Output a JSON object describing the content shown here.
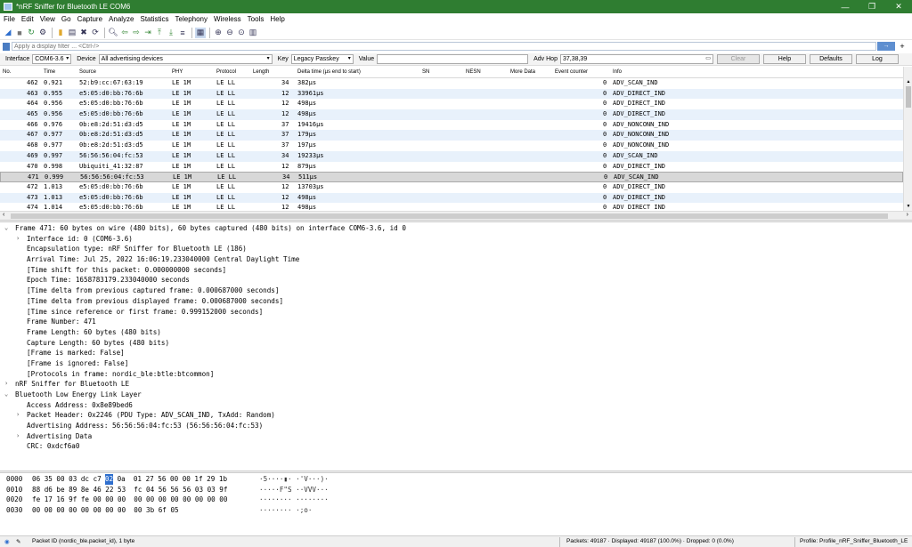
{
  "window": {
    "title": "*nRF Sniffer for Bluetooth LE COM6",
    "controls": [
      "—",
      "❐",
      "✕"
    ]
  },
  "menu": [
    "File",
    "Edit",
    "View",
    "Go",
    "Capture",
    "Analyze",
    "Statistics",
    "Telephony",
    "Wireless",
    "Tools",
    "Help"
  ],
  "filter": {
    "placeholder": "Apply a display filter ... <Ctrl-/>",
    "apply": "→",
    "plus": "+"
  },
  "iface": {
    "interface_label": "Interface",
    "interface_value": "COM6-3.6",
    "device_label": "Device",
    "device_value": "All advertising devices",
    "key_label": "Key",
    "key_value": "Legacy Passkey",
    "value_label": "Value",
    "value_value": "",
    "advhop_label": "Adv Hop",
    "advhop_value": "37,38,39",
    "clear": "Clear",
    "help": "Help",
    "defaults": "Defaults",
    "log": "Log"
  },
  "columns": [
    "No.",
    "Time",
    "Source",
    "PHY",
    "Protocol",
    "Length",
    "Delta time (µs end to start)",
    "SN",
    "NESN",
    "More Data",
    "Event counter",
    "Info"
  ],
  "packets": [
    {
      "no": "462",
      "time": "0.921",
      "src": "52:b9:cc:67:63:19",
      "phy": "LE 1M",
      "proto": "LE LL",
      "len": "34",
      "delta": "382µs",
      "ec": "0",
      "info": "ADV_SCAN_IND"
    },
    {
      "no": "463",
      "time": "0.955",
      "src": "e5:05:d0:bb:76:6b",
      "phy": "LE 1M",
      "proto": "LE LL",
      "len": "12",
      "delta": "33961µs",
      "ec": "0",
      "info": "ADV_DIRECT_IND"
    },
    {
      "no": "464",
      "time": "0.956",
      "src": "e5:05:d0:bb:76:6b",
      "phy": "LE 1M",
      "proto": "LE LL",
      "len": "12",
      "delta": "498µs",
      "ec": "0",
      "info": "ADV_DIRECT_IND"
    },
    {
      "no": "465",
      "time": "0.956",
      "src": "e5:05:d0:bb:76:6b",
      "phy": "LE 1M",
      "proto": "LE LL",
      "len": "12",
      "delta": "498µs",
      "ec": "0",
      "info": "ADV_DIRECT_IND"
    },
    {
      "no": "466",
      "time": "0.976",
      "src": "0b:e8:2d:51:d3:d5",
      "phy": "LE 1M",
      "proto": "LE LL",
      "len": "37",
      "delta": "19416µs",
      "ec": "0",
      "info": "ADV_NONCONN_IND"
    },
    {
      "no": "467",
      "time": "0.977",
      "src": "0b:e8:2d:51:d3:d5",
      "phy": "LE 1M",
      "proto": "LE LL",
      "len": "37",
      "delta": "179µs",
      "ec": "0",
      "info": "ADV_NONCONN_IND"
    },
    {
      "no": "468",
      "time": "0.977",
      "src": "0b:e8:2d:51:d3:d5",
      "phy": "LE 1M",
      "proto": "LE LL",
      "len": "37",
      "delta": "197µs",
      "ec": "0",
      "info": "ADV_NONCONN_IND"
    },
    {
      "no": "469",
      "time": "0.997",
      "src": "56:56:56:04:fc:53",
      "phy": "LE 1M",
      "proto": "LE LL",
      "len": "34",
      "delta": "19233µs",
      "ec": "0",
      "info": "ADV_SCAN_IND"
    },
    {
      "no": "470",
      "time": "0.998",
      "src": "Ubiquiti_41:32:87",
      "phy": "LE 1M",
      "proto": "LE LL",
      "len": "12",
      "delta": "879µs",
      "ec": "0",
      "info": "ADV_DIRECT_IND"
    },
    {
      "no": "471",
      "time": "0.999",
      "src": "56:56:56:04:fc:53",
      "phy": "LE 1M",
      "proto": "LE LL",
      "len": "34",
      "delta": "511µs",
      "ec": "0",
      "info": "ADV_SCAN_IND"
    },
    {
      "no": "472",
      "time": "1.013",
      "src": "e5:05:d0:bb:76:6b",
      "phy": "LE 1M",
      "proto": "LE LL",
      "len": "12",
      "delta": "13703µs",
      "ec": "0",
      "info": "ADV_DIRECT_IND"
    },
    {
      "no": "473",
      "time": "1.013",
      "src": "e5:05:d0:bb:76:6b",
      "phy": "LE 1M",
      "proto": "LE LL",
      "len": "12",
      "delta": "498µs",
      "ec": "0",
      "info": "ADV_DIRECT_IND"
    },
    {
      "no": "474",
      "time": "1.014",
      "src": "e5:05:d0:bb:76:6b",
      "phy": "LE 1M",
      "proto": "LE LL",
      "len": "12",
      "delta": "498µs",
      "ec": "0",
      "info": "ADV_DIRECT_IND"
    }
  ],
  "selected_packet": "471",
  "details": [
    {
      "lvl": 0,
      "arrow": "⌄",
      "t": "Frame 471: 60 bytes on wire (480 bits), 60 bytes captured (480 bits) on interface COM6-3.6, id 0"
    },
    {
      "lvl": 1,
      "arrow": "›",
      "t": "Interface id: 0 (COM6-3.6)"
    },
    {
      "lvl": 1,
      "arrow": "",
      "t": "Encapsulation type: nRF Sniffer for Bluetooth LE (186)"
    },
    {
      "lvl": 1,
      "arrow": "",
      "t": "Arrival Time: Jul 25, 2022 16:06:19.233040000 Central Daylight Time"
    },
    {
      "lvl": 1,
      "arrow": "",
      "t": "[Time shift for this packet: 0.000000000 seconds]"
    },
    {
      "lvl": 1,
      "arrow": "",
      "t": "Epoch Time: 1658783179.233040000 seconds"
    },
    {
      "lvl": 1,
      "arrow": "",
      "t": "[Time delta from previous captured frame: 0.000687000 seconds]"
    },
    {
      "lvl": 1,
      "arrow": "",
      "t": "[Time delta from previous displayed frame: 0.000687000 seconds]"
    },
    {
      "lvl": 1,
      "arrow": "",
      "t": "[Time since reference or first frame: 0.999152000 seconds]"
    },
    {
      "lvl": 1,
      "arrow": "",
      "t": "Frame Number: 471"
    },
    {
      "lvl": 1,
      "arrow": "",
      "t": "Frame Length: 60 bytes (480 bits)"
    },
    {
      "lvl": 1,
      "arrow": "",
      "t": "Capture Length: 60 bytes (480 bits)"
    },
    {
      "lvl": 1,
      "arrow": "",
      "t": "[Frame is marked: False]"
    },
    {
      "lvl": 1,
      "arrow": "",
      "t": "[Frame is ignored: False]"
    },
    {
      "lvl": 1,
      "arrow": "",
      "t": "[Protocols in frame: nordic_ble:btle:btcommon]"
    },
    {
      "lvl": 0,
      "arrow": "›",
      "t": "nRF Sniffer for Bluetooth LE"
    },
    {
      "lvl": 0,
      "arrow": "⌄",
      "t": "Bluetooth Low Energy Link Layer"
    },
    {
      "lvl": 1,
      "arrow": "",
      "t": "Access Address: 0x8e89bed6"
    },
    {
      "lvl": 1,
      "arrow": "›",
      "t": "Packet Header: 0x2246 (PDU Type: ADV_SCAN_IND, TxAdd: Random)"
    },
    {
      "lvl": 1,
      "arrow": "",
      "t": "Advertising Address: 56:56:56:04:fc:53 (56:56:56:04:fc:53)"
    },
    {
      "lvl": 1,
      "arrow": "›",
      "t": "Advertising Data"
    },
    {
      "lvl": 1,
      "arrow": "",
      "t": "CRC: 0xdcf6a0"
    }
  ],
  "hex": [
    {
      "off": "0000",
      "pre": "06 35 00 03 dc c7 ",
      "hl": "02",
      "post": " 0a  01 27 56 00 00 1f 29 1b",
      "ascii": "·5····▮· ·'V···)·"
    },
    {
      "off": "0010",
      "pre": "88 d6 be 89 8e 46 22 53  fc 04 56 56 56 03 03 9f",
      "hl": "",
      "post": "",
      "ascii": "·····F\"S ··VVV···"
    },
    {
      "off": "0020",
      "pre": "fe 17 16 9f fe 00 00 00  00 00 00 00 00 00 00 00",
      "hl": "",
      "post": "",
      "ascii": "········ ········"
    },
    {
      "off": "0030",
      "pre": "00 00 00 00 00 00 00 00  00 3b 6f 05",
      "hl": "",
      "post": "",
      "ascii": "········ ·;o·"
    }
  ],
  "status": {
    "field": "Packet ID (nordic_ble.packet_id), 1 byte",
    "packets": "Packets: 49187 · Displayed: 49187 (100.0%) · Dropped: 0 (0.0%)",
    "profile": "Profile: Profile_nRF_Sniffer_Bluetooth_LE"
  }
}
